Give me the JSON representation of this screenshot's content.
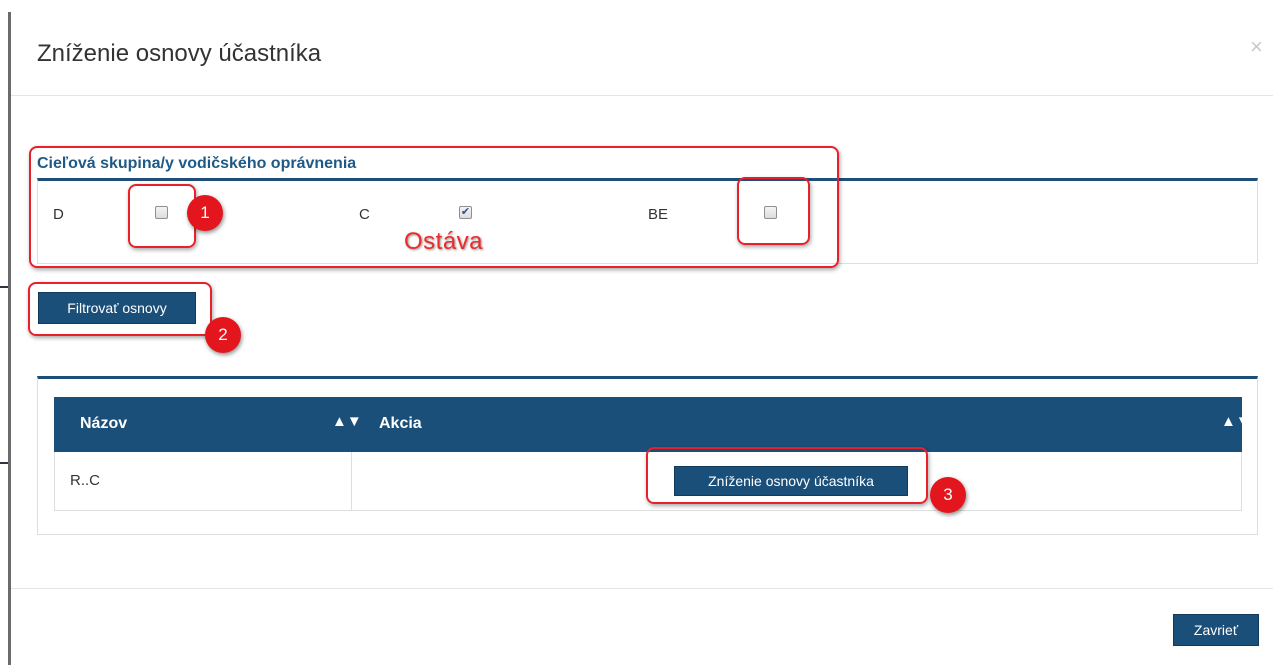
{
  "modal": {
    "title": "Zníženie osnovy účastníka",
    "close": "×"
  },
  "filter": {
    "group_label": "Cieľová skupina/y vodičského oprávnenia",
    "checkboxes": [
      {
        "label": "D",
        "checked": false
      },
      {
        "label": "C",
        "checked": true
      },
      {
        "label": "BE",
        "checked": false
      }
    ],
    "button_label": "Filtrovať osnovy"
  },
  "table": {
    "columns": [
      "Názov",
      "Akcia"
    ],
    "rows": [
      {
        "name": "R..C",
        "action_label": "Zníženie osnovy účastníka"
      }
    ]
  },
  "footer": {
    "close_label": "Zavrieť"
  },
  "annotations": {
    "badges": [
      "1",
      "2",
      "3"
    ],
    "note": "Ostáva"
  },
  "colors": {
    "primary": "#1a4f7a",
    "accent_line": "#1f4e79",
    "annotation_red": "#e3161e"
  },
  "icons": {
    "close": "close-icon",
    "sort": "sort-icon",
    "checkmark": "checkmark-icon"
  }
}
